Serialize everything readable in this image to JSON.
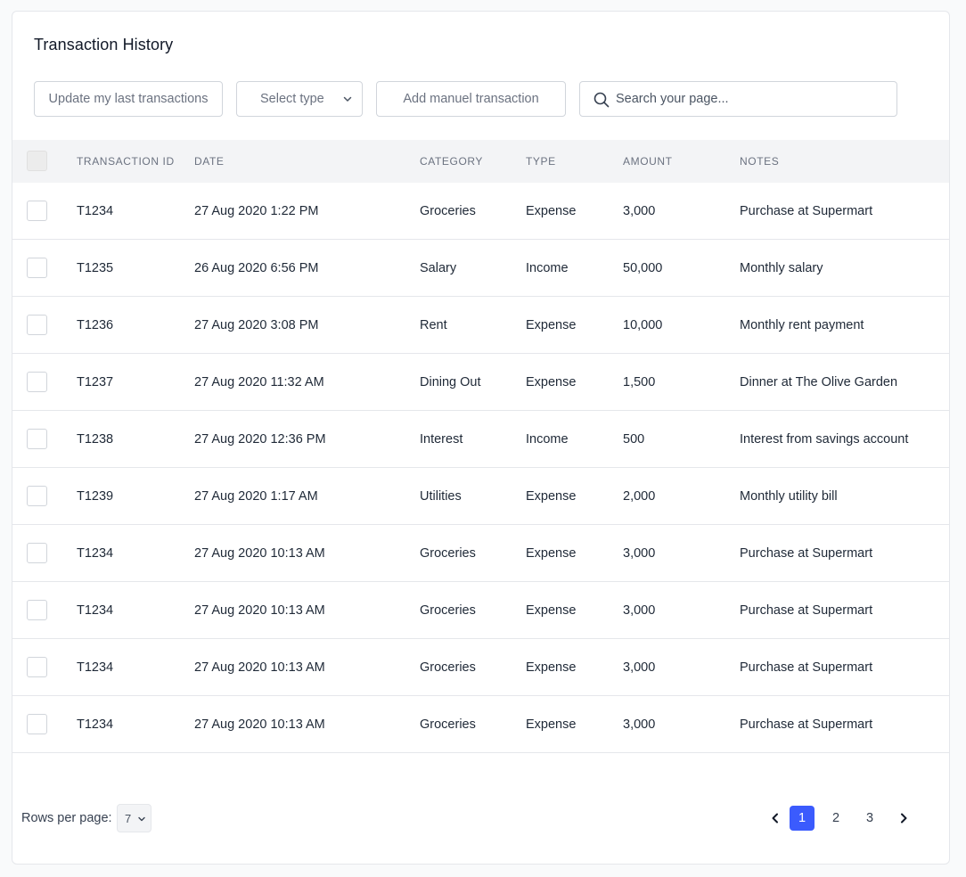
{
  "title": "Transaction History",
  "toolbar": {
    "update_label": "Update my last transactions",
    "select_type_label": "Select type",
    "add_label": "Add manuel transaction",
    "search_placeholder": "Search your page..."
  },
  "columns": {
    "id": "TRANSACTION ID",
    "date": "DATE",
    "category": "CATEGORY",
    "type": "TYPE",
    "amount": "AMOUNT",
    "notes": "NOTES"
  },
  "rows": [
    {
      "id": "T1234",
      "date": "27 Aug 2020 1:22 PM",
      "category": "Groceries",
      "type": "Expense",
      "amount": "3,000",
      "notes": "Purchase at Supermart"
    },
    {
      "id": "T1235",
      "date": "26 Aug 2020 6:56 PM",
      "category": "Salary",
      "type": "Income",
      "amount": "50,000",
      "notes": "Monthly salary"
    },
    {
      "id": "T1236",
      "date": "27 Aug 2020 3:08 PM",
      "category": "Rent",
      "type": "Expense",
      "amount": "10,000",
      "notes": "Monthly rent payment"
    },
    {
      "id": "T1237",
      "date": "27 Aug 2020 11:32 AM",
      "category": "Dining Out",
      "type": "Expense",
      "amount": "1,500",
      "notes": "Dinner at The Olive Garden"
    },
    {
      "id": "T1238",
      "date": "27 Aug 2020 12:36 PM",
      "category": "Interest",
      "type": "Income",
      "amount": "500",
      "notes": "Interest from savings account"
    },
    {
      "id": "T1239",
      "date": "27 Aug 2020 1:17 AM",
      "category": "Utilities",
      "type": "Expense",
      "amount": "2,000",
      "notes": "Monthly utility bill"
    },
    {
      "id": "T1234",
      "date": "27 Aug 2020 10:13 AM",
      "category": "Groceries",
      "type": "Expense",
      "amount": "3,000",
      "notes": "Purchase at Supermart"
    },
    {
      "id": "T1234",
      "date": "27 Aug 2020 10:13 AM",
      "category": "Groceries",
      "type": "Expense",
      "amount": "3,000",
      "notes": "Purchase at Supermart"
    },
    {
      "id": "T1234",
      "date": "27 Aug 2020 10:13 AM",
      "category": "Groceries",
      "type": "Expense",
      "amount": "3,000",
      "notes": "Purchase at Supermart"
    },
    {
      "id": "T1234",
      "date": "27 Aug 2020 10:13 AM",
      "category": "Groceries",
      "type": "Expense",
      "amount": "3,000",
      "notes": "Purchase at Supermart"
    }
  ],
  "footer": {
    "rows_per_page_label": "Rows per page:",
    "rows_per_page_value": "7"
  },
  "pagination": {
    "pages": [
      "1",
      "2",
      "3"
    ],
    "current": "1"
  },
  "colors": {
    "accent": "#3b5bfd",
    "header_bg": "#f3f4f6",
    "border": "#e5e7eb"
  },
  "icons": {
    "search": "search-icon",
    "select_chevron": "chevron-down-icon",
    "prev": "chevron-left-icon",
    "next": "chevron-right-icon"
  }
}
